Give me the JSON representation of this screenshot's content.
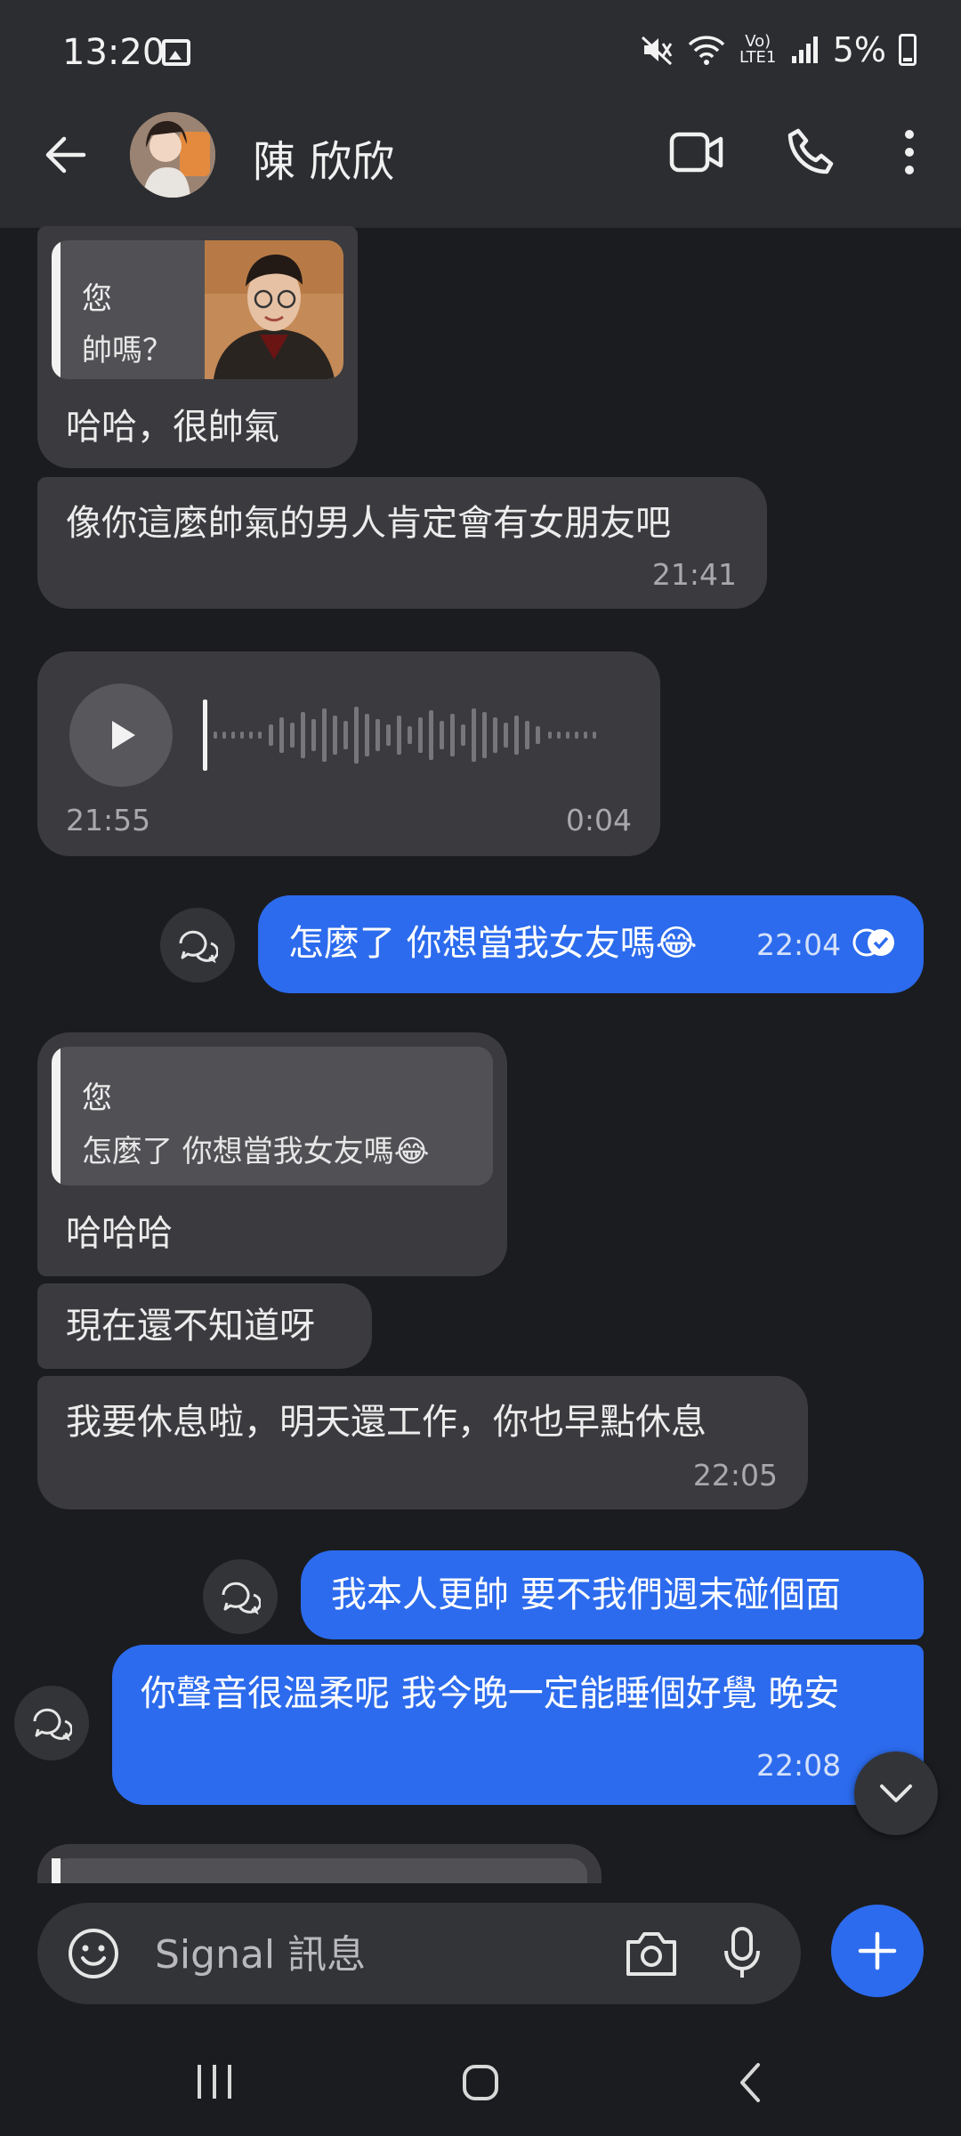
{
  "status_bar": {
    "time": "13:20",
    "network": "Vo) LTE1",
    "battery": "5%"
  },
  "header": {
    "contact_name": "陳 欣欣"
  },
  "messages": {
    "m1": {
      "quote_author": "您",
      "quote_text": "帥嗎？",
      "text": "哈哈，很帥氣"
    },
    "m2": {
      "text": "像你這麼帥氣的男人肯定會有女朋友吧",
      "time": "21:41"
    },
    "m3": {
      "time": "21:55",
      "duration": "0:04"
    },
    "m4": {
      "text": "怎麼了 你想當我女友嗎😂",
      "time": "22:04"
    },
    "m5": {
      "quote_author": "您",
      "quote_text": "怎麼了 你想當我女友嗎😂",
      "text": "哈哈哈"
    },
    "m6": {
      "text": "現在還不知道呀"
    },
    "m7": {
      "text": "我要休息啦，明天還工作，你也早點休息",
      "time": "22:05"
    },
    "m8": {
      "text": "我本人更帥 要不我們週末碰個面"
    },
    "m9": {
      "text": "你聲音很溫柔呢 我今晚一定能睡個好覺 晚安",
      "time": "22:08"
    }
  },
  "composer": {
    "placeholder": "Signal 訊息"
  },
  "colors": {
    "accent": "#2c6bed",
    "background": "#1b1c1f",
    "incoming_bubble": "#3b3b3f"
  }
}
